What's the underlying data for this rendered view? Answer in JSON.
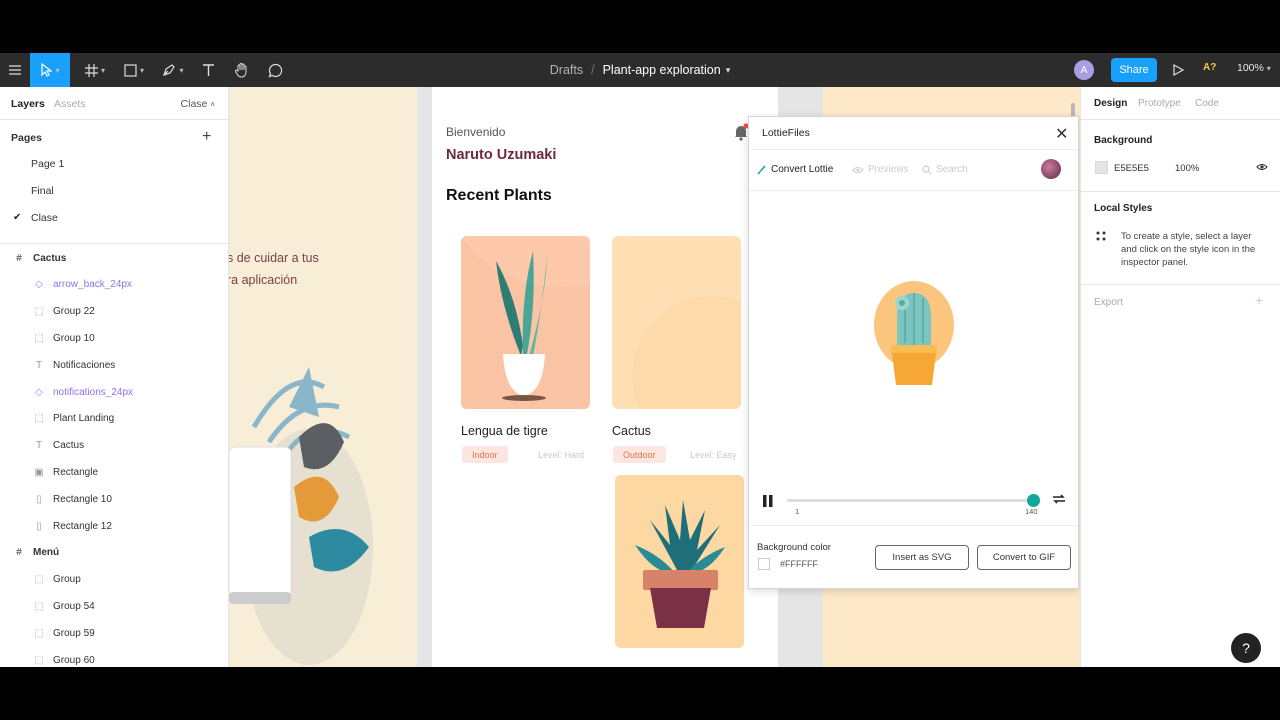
{
  "toolbar": {
    "menu_icon": "hamburger-icon",
    "tools": [
      "move-tool",
      "frame-tool",
      "shape-tool",
      "pen-tool",
      "text-tool",
      "hand-tool",
      "comment-tool"
    ],
    "breadcrumb_root": "Drafts",
    "breadcrumb_sep": "/",
    "file_name": "Plant-app exploration",
    "file_caret": "⌄",
    "avatar_initial": "A",
    "share_label": "Share",
    "ap_label": "A?",
    "zoom": "100%"
  },
  "left_panel": {
    "tab_layers": "Layers",
    "tab_assets": "Assets",
    "current_page": "Clase",
    "pages_header": "Pages",
    "add_page": "+",
    "pages": [
      "Page 1",
      "Final",
      "Clase"
    ],
    "selected_page": "Clase",
    "layers": [
      {
        "label": "Cactus",
        "icon": "frame-icon",
        "depth": 0
      },
      {
        "label": "arrow_back_24px",
        "icon": "component-icon",
        "depth": 1,
        "component": true
      },
      {
        "label": "Group 22",
        "icon": "group-icon",
        "depth": 1
      },
      {
        "label": "Group 10",
        "icon": "group-icon",
        "depth": 1
      },
      {
        "label": "Notificaciones",
        "icon": "text-icon",
        "depth": 1
      },
      {
        "label": "notifications_24px",
        "icon": "component-icon",
        "depth": 1,
        "component": true
      },
      {
        "label": "Plant Landing",
        "icon": "group-icon",
        "depth": 1
      },
      {
        "label": "Cactus",
        "icon": "text-icon",
        "depth": 1
      },
      {
        "label": "Rectangle",
        "icon": "image-icon",
        "depth": 1
      },
      {
        "label": "Rectangle 10",
        "icon": "rectangle-icon",
        "depth": 1
      },
      {
        "label": "Rectangle 12",
        "icon": "rectangle-thin-icon",
        "depth": 1
      },
      {
        "label": "Menú",
        "icon": "frame-icon",
        "depth": 0
      },
      {
        "label": "Group",
        "icon": "group-icon",
        "depth": 1
      },
      {
        "label": "Group 54",
        "icon": "group-icon",
        "depth": 1
      },
      {
        "label": "Group 59",
        "icon": "group-icon",
        "depth": 1
      },
      {
        "label": "Group 60",
        "icon": "group-icon",
        "depth": 1
      }
    ]
  },
  "canvas": {
    "left_frame_lines": [
      "s de cuidar a tus",
      "ra aplicación"
    ],
    "greeting": "Bienvenido",
    "user_name": "Naruto Uzumaki",
    "section_title": "Recent Plants",
    "plants": [
      {
        "name": "Lengua de tigre",
        "tag": "Indoor",
        "level": "Level: Hard"
      },
      {
        "name": "Cactus",
        "tag": "Outdoor",
        "level": "Level: Easy"
      }
    ]
  },
  "plugin": {
    "title": "LottieFiles",
    "nav": [
      "Convert Lottie",
      "Previews",
      "Search"
    ],
    "frame_start": "1",
    "frame_end": "140",
    "progress": 1.0,
    "bg_label": "Background color",
    "bg_value": "#FFFFFF",
    "insert_svg": "Insert as SVG",
    "convert_gif": "Convert to GIF"
  },
  "right_panel": {
    "tab_design": "Design",
    "tab_prototype": "Prototype",
    "tab_code": "Code",
    "background_header": "Background",
    "bg_hex": "E5E5E5",
    "bg_opacity": "100%",
    "local_styles_header": "Local Styles",
    "local_styles_help": "To create a style, select a layer and click on the style icon in the inspector panel.",
    "export_label": "Export",
    "export_add": "+"
  },
  "help_label": "?",
  "colors": {
    "accent": "#18a0fb",
    "toolbar_bg": "#2c2c2c",
    "teal": "#0fa89b",
    "brand_text": "#6e2a3a"
  }
}
